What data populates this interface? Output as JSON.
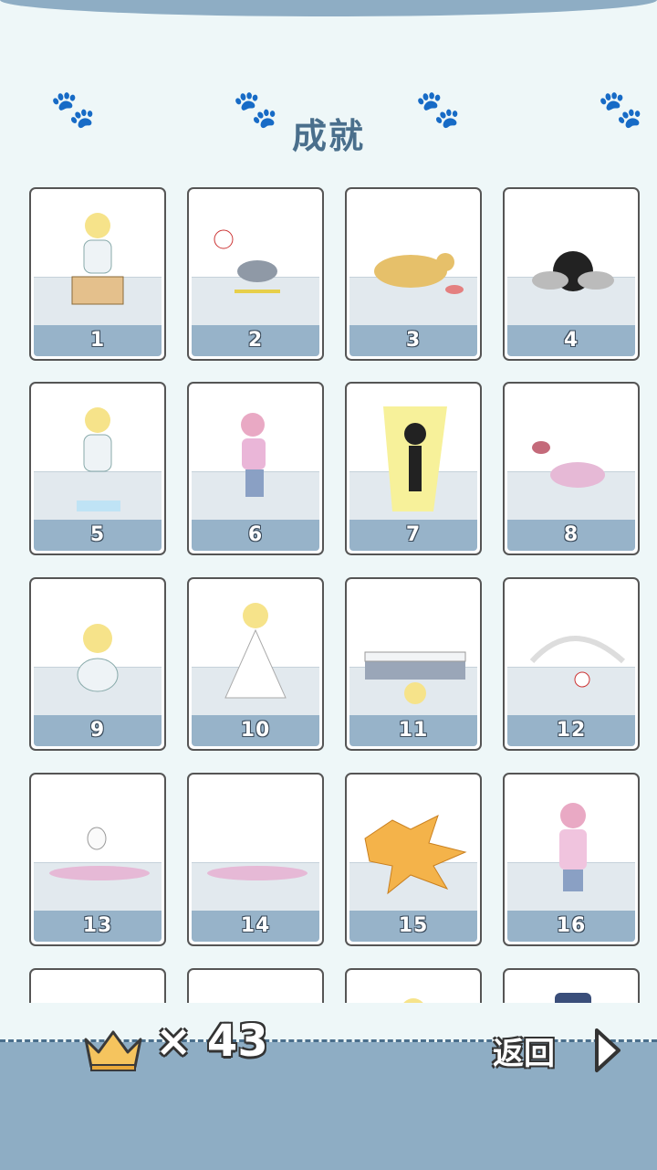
{
  "title": "成就",
  "achievements": [
    {
      "number": "1",
      "icon": "cat-girl-box-icon"
    },
    {
      "number": "2",
      "icon": "angry-cat-icon"
    },
    {
      "number": "3",
      "icon": "dog-food-bowl-icon"
    },
    {
      "number": "4",
      "icon": "black-cat-smoke-icon"
    },
    {
      "number": "5",
      "icon": "cat-girl-ice-icon"
    },
    {
      "number": "6",
      "icon": "girl-jumping-icon"
    },
    {
      "number": "7",
      "icon": "electric-skeleton-icon"
    },
    {
      "number": "8",
      "icon": "girl-falling-icon"
    },
    {
      "number": "9",
      "icon": "cat-girl-crouch-icon"
    },
    {
      "number": "10",
      "icon": "dress-girl-icon"
    },
    {
      "number": "11",
      "icon": "under-bed-icon"
    },
    {
      "number": "12",
      "icon": "dust-cloud-icon"
    },
    {
      "number": "13",
      "icon": "girl-ghost-icon"
    },
    {
      "number": "14",
      "icon": "girl-lying-icon"
    },
    {
      "number": "15",
      "icon": "explosion-icon"
    },
    {
      "number": "16",
      "icon": "girl-standing-icon"
    },
    {
      "number": "",
      "icon": "locked-card"
    },
    {
      "number": "",
      "icon": "locked-card"
    },
    {
      "number": "",
      "icon": "blonde-character-icon"
    },
    {
      "number": "",
      "icon": "police-character-icon"
    }
  ],
  "crown_count": "× 43",
  "back_label": "返回",
  "colors": {
    "accent": "#8eadc4",
    "title": "#4a6f8c",
    "background": "#eef7f8"
  }
}
